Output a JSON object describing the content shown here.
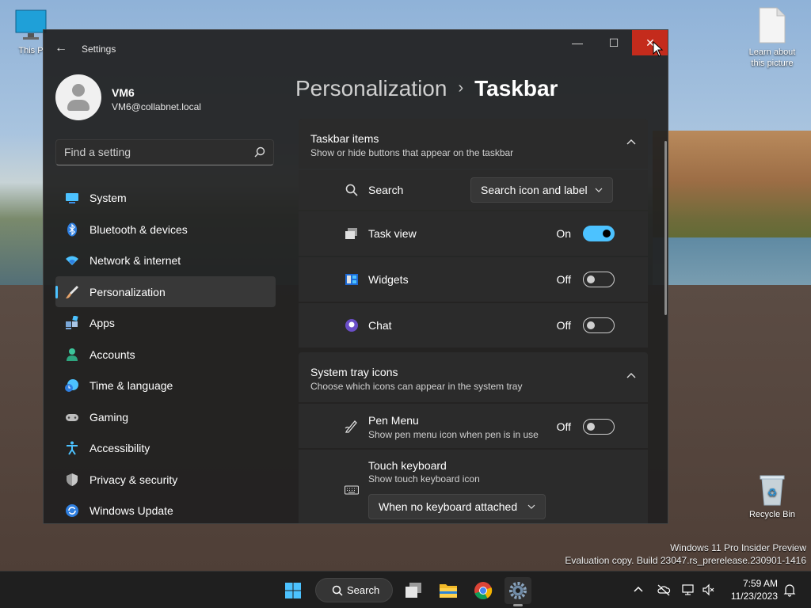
{
  "desktop": {
    "icons": [
      {
        "label": "This PC",
        "visible_label": "This P"
      },
      {
        "label": "Learn about this picture"
      },
      {
        "label": "Recycle Bin"
      }
    ],
    "watermark_line1": "Windows 11 Pro Insider Preview",
    "watermark_line2": "Evaluation copy. Build 23047.rs_prerelease.230901-1416"
  },
  "window": {
    "title": "Settings",
    "min_glyph": "—",
    "max_glyph": "☐",
    "close_glyph": "✕",
    "back_glyph": "←"
  },
  "profile": {
    "name": "VM6",
    "email": "VM6@collabnet.local"
  },
  "search": {
    "placeholder": "Find a setting"
  },
  "nav": {
    "items": [
      {
        "label": "System",
        "icon": "system-icon",
        "color": "#4cc2ff"
      },
      {
        "label": "Bluetooth & devices",
        "icon": "bluetooth-icon",
        "color": "#3a8ee6"
      },
      {
        "label": "Network & internet",
        "icon": "wifi-icon",
        "color": "#4cc2ff"
      },
      {
        "label": "Personalization",
        "icon": "brush-icon",
        "color": "#e5a36b",
        "active": true
      },
      {
        "label": "Apps",
        "icon": "apps-icon",
        "color": "#7aa7d8"
      },
      {
        "label": "Accounts",
        "icon": "accounts-icon",
        "color": "#3cc49a"
      },
      {
        "label": "Time & language",
        "icon": "time-language-icon",
        "color": "#4cc2ff"
      },
      {
        "label": "Gaming",
        "icon": "gaming-icon",
        "color": "#bdbdbd"
      },
      {
        "label": "Accessibility",
        "icon": "accessibility-icon",
        "color": "#4cc2ff"
      },
      {
        "label": "Privacy & security",
        "icon": "shield-icon",
        "color": "#9a9a9a"
      },
      {
        "label": "Windows Update",
        "icon": "update-icon",
        "color": "#4cc2ff"
      }
    ]
  },
  "breadcrumb": {
    "parent": "Personalization",
    "separator": "›",
    "current": "Taskbar"
  },
  "taskbar_items": {
    "title": "Taskbar items",
    "subtitle": "Show or hide buttons that appear on the taskbar",
    "rows": [
      {
        "label": "Search",
        "control": "dropdown",
        "value": "Search icon and label"
      },
      {
        "label": "Task view",
        "control": "toggle",
        "state": "On",
        "on": true
      },
      {
        "label": "Widgets",
        "control": "toggle",
        "state": "Off",
        "on": false
      },
      {
        "label": "Chat",
        "control": "toggle",
        "state": "Off",
        "on": false
      }
    ]
  },
  "system_tray": {
    "title": "System tray icons",
    "subtitle": "Choose which icons can appear in the system tray",
    "pen_menu": {
      "label": "Pen Menu",
      "sub": "Show pen menu icon when pen is in use",
      "state": "Off"
    },
    "touch_keyboard": {
      "label": "Touch keyboard",
      "sub": "Show touch keyboard icon",
      "value": "When no keyboard attached"
    }
  },
  "taskbar": {
    "search_label": "Search",
    "time": "7:59 AM",
    "date": "11/23/2023"
  },
  "colors": {
    "accent": "#4cc2ff",
    "close_red": "#c42b1c",
    "window_bg": "#202020",
    "card_bg": "#2b2b2b"
  }
}
